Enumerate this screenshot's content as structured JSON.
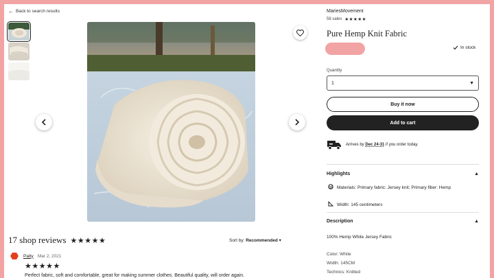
{
  "nav": {
    "back_label": "Back to search results"
  },
  "gallery": {
    "thumbnails": [
      "fabric-roll-thumbnail",
      "fabric-fold-thumbnail",
      "fabric-white-thumbnail"
    ],
    "prev_icon": "chevron-left-icon",
    "next_icon": "chevron-right-icon",
    "favorite_icon": "heart-icon"
  },
  "reviews": {
    "count_label": "17 shop reviews",
    "stars": "★★★★★",
    "sort_prefix": "Sort by:",
    "sort_value": "Recommended",
    "first": {
      "name": "Patty",
      "date": "Mar 2, 2021",
      "stars": "★★★★★",
      "text": "Perfect fabric, soft and comfortable, great for making summer clothes. Beautiful quality, will order again."
    }
  },
  "shop": {
    "name": "MariesMovement",
    "sales": "58 sales",
    "rating_stars": "★★★★★"
  },
  "product": {
    "title": "Pure Hemp Knit Fabric",
    "price_color": "#f2a3a3",
    "stock": "In stock"
  },
  "quantity": {
    "label": "Quantity",
    "value": "1"
  },
  "actions": {
    "buy_now": "Buy it now",
    "add_to_cart": "Add to cart"
  },
  "shipping": {
    "prefix": "Arrives by",
    "dates": "Dec 24-31",
    "suffix": "if you order today.",
    "icon": "truck-icon"
  },
  "highlights": {
    "heading": "Highlights",
    "items": [
      "Materials: Primary fabric: Jersey knit; Primary fiber: Hemp",
      "Width: 145 centimeters"
    ]
  },
  "description": {
    "heading": "Description",
    "lines": [
      "100% Hemp White Jersey Fabric",
      "Color: White",
      "Width: 145CM",
      "Technics: Knitted"
    ]
  },
  "colors": {
    "frame": "#f2a3a3",
    "button_dark": "#222222"
  }
}
